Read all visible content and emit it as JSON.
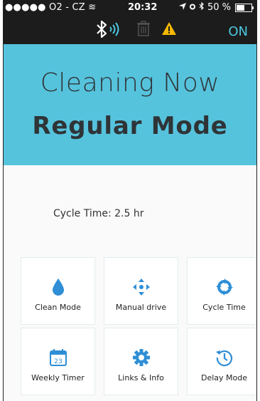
{
  "status": {
    "signal": "●●●●● O2 - CZ",
    "wifi": "≋",
    "time": "20:32",
    "battery_text": "50 %",
    "battery_level": 0.5
  },
  "toolbar": {
    "on_label": "ON"
  },
  "hero": {
    "line1": "Cleaning Now",
    "line2": "Regular Mode"
  },
  "cycle_time": "Cycle Time: 2.5 hr",
  "tiles": [
    {
      "label": "Clean Mode",
      "icon": "water-drop-icon"
    },
    {
      "label": "Manual drive",
      "icon": "arrows-icon"
    },
    {
      "label": "Cycle Time",
      "icon": "cycle-icon"
    },
    {
      "label": "Weekly Timer",
      "icon": "calendar-icon",
      "icon_text": "23"
    },
    {
      "label": "Links & Info",
      "icon": "gear-icon"
    },
    {
      "label": "Delay Mode",
      "icon": "clock-icon"
    }
  ],
  "colors": {
    "header_bg": "#56c3dd",
    "accent": "#2f8ed6",
    "on_color": "#4ec8e0",
    "warning": "#f5b800"
  }
}
